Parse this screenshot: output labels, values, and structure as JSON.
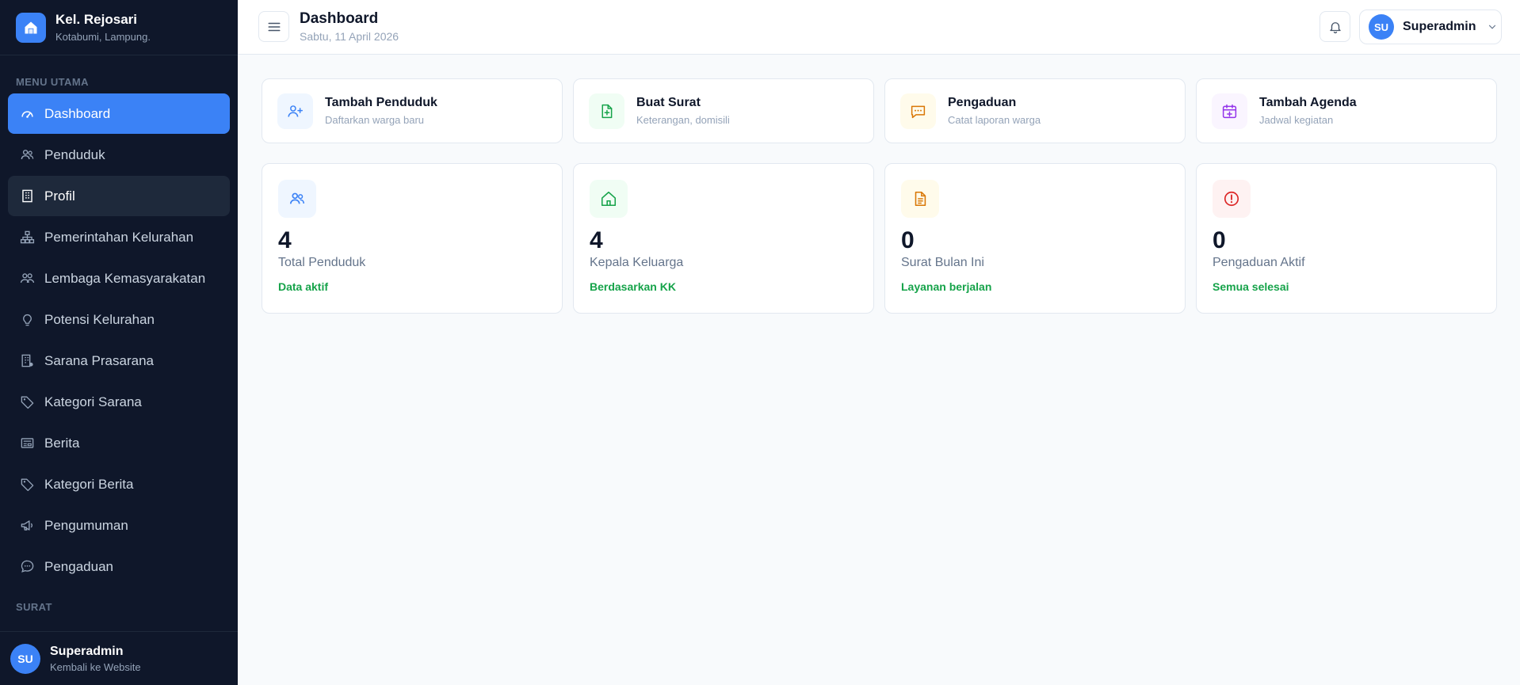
{
  "brand": {
    "name": "Kel. Rejosari",
    "subtitle": "Kotabumi, Lampung."
  },
  "sidebar": {
    "section_main": "MENU UTAMA",
    "section_surat": "SURAT",
    "items": [
      {
        "label": "Dashboard",
        "icon": "gauge-icon",
        "state": "active"
      },
      {
        "label": "Penduduk",
        "icon": "users-icon",
        "state": ""
      },
      {
        "label": "Profil",
        "icon": "building-icon",
        "state": "hover"
      },
      {
        "label": "Pemerintahan Kelurahan",
        "icon": "org-chart-icon",
        "state": ""
      },
      {
        "label": "Lembaga Kemasyarakatan",
        "icon": "people-group-icon",
        "state": ""
      },
      {
        "label": "Potensi Kelurahan",
        "icon": "lightbulb-icon",
        "state": ""
      },
      {
        "label": "Sarana Prasarana",
        "icon": "building-gear-icon",
        "state": ""
      },
      {
        "label": "Kategori Sarana",
        "icon": "tag-icon",
        "state": ""
      },
      {
        "label": "Berita",
        "icon": "newspaper-icon",
        "state": ""
      },
      {
        "label": "Kategori Berita",
        "icon": "tag-icon",
        "state": ""
      },
      {
        "label": "Pengumuman",
        "icon": "megaphone-icon",
        "state": ""
      },
      {
        "label": "Pengaduan",
        "icon": "chat-bubble-icon",
        "state": ""
      }
    ],
    "footer": {
      "initials": "SU",
      "name": "Superadmin",
      "subtitle": "Kembali ke Website"
    }
  },
  "header": {
    "title": "Dashboard",
    "date": "Sabtu, 11 April 2026",
    "user": {
      "initials": "SU",
      "name": "Superadmin"
    }
  },
  "quick_actions": [
    {
      "title": "Tambah Penduduk",
      "subtitle": "Daftarkan warga baru",
      "icon": "user-plus-icon",
      "color": "#3b82f6",
      "bg": "#eff6ff"
    },
    {
      "title": "Buat Surat",
      "subtitle": "Keterangan, domisili",
      "icon": "file-plus-icon",
      "color": "#16a34a",
      "bg": "#f0fdf4"
    },
    {
      "title": "Pengaduan",
      "subtitle": "Catat laporan warga",
      "icon": "chat-dots-icon",
      "color": "#d97706",
      "bg": "#fffbeb"
    },
    {
      "title": "Tambah Agenda",
      "subtitle": "Jadwal kegiatan",
      "icon": "calendar-plus-icon",
      "color": "#9333ea",
      "bg": "#faf5ff"
    }
  ],
  "stats": [
    {
      "value": "4",
      "label": "Total Penduduk",
      "note": "Data aktif",
      "icon": "users-icon",
      "color": "#3b82f6",
      "bg": "#eff6ff"
    },
    {
      "value": "4",
      "label": "Kepala Keluarga",
      "note": "Berdasarkan KK",
      "icon": "home-icon",
      "color": "#16a34a",
      "bg": "#f0fdf4"
    },
    {
      "value": "0",
      "label": "Surat Bulan Ini",
      "note": "Layanan berjalan",
      "icon": "document-icon",
      "color": "#d97706",
      "bg": "#fffbeb"
    },
    {
      "value": "0",
      "label": "Pengaduan Aktif",
      "note": "Semua selesai",
      "icon": "alert-circle-icon",
      "color": "#dc2626",
      "bg": "#fef2f2"
    }
  ],
  "colors": {
    "accent": "#3b82f6",
    "sidebar_bg": "#0f172a",
    "note_green": "#16a34a"
  }
}
